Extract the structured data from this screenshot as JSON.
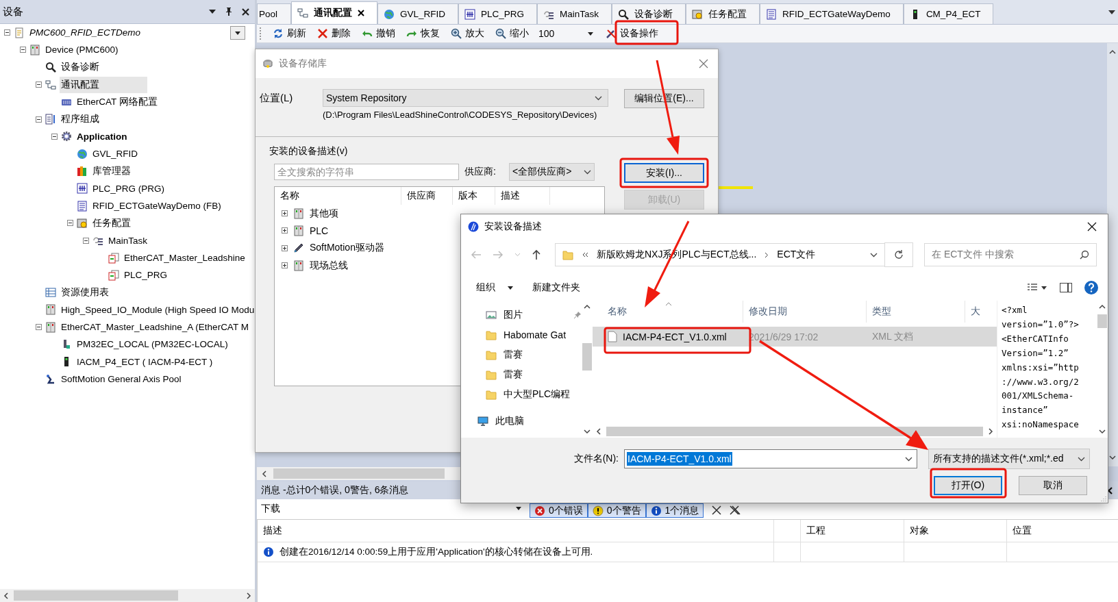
{
  "device_panel": {
    "title": "设备",
    "tree": [
      {
        "label": "PMC600_RFID_ECTDemo",
        "kind": "project",
        "expanded": true,
        "selected": false,
        "children": [
          {
            "label": "Device (PMC600)",
            "kind": "device",
            "expanded": true,
            "selected": false,
            "children": [
              {
                "label": "设备诊断",
                "kind": "diagnosis",
                "selected": false
              },
              {
                "label": "通讯配置",
                "kind": "network",
                "expanded": true,
                "selected": true,
                "children": [
                  {
                    "label": "EtherCAT 网络配置",
                    "kind": "ethercat",
                    "selected": false
                  }
                ]
              },
              {
                "label": "程序组成",
                "kind": "program",
                "expanded": true,
                "selected": false,
                "children": [
                  {
                    "label": "Application",
                    "kind": "application",
                    "expanded": true,
                    "selected": false,
                    "children": [
                      {
                        "label": "GVL_RFID",
                        "kind": "globe",
                        "selected": false
                      },
                      {
                        "label": "库管理器",
                        "kind": "library",
                        "selected": false
                      },
                      {
                        "label": "PLC_PRG (PRG)",
                        "kind": "pou",
                        "selected": false
                      },
                      {
                        "label": "RFID_ECTGateWayDemo (FB)",
                        "kind": "doc",
                        "selected": false
                      },
                      {
                        "label": "任务配置",
                        "kind": "task_config",
                        "expanded": true,
                        "selected": false,
                        "children": [
                          {
                            "label": "MainTask",
                            "kind": "task",
                            "expanded": true,
                            "selected": false,
                            "children": [
                              {
                                "label": "EtherCAT_Master_Leadshine",
                                "kind": "call",
                                "selected": false
                              },
                              {
                                "label": "PLC_PRG",
                                "kind": "call",
                                "selected": false
                              }
                            ]
                          }
                        ]
                      }
                    ]
                  }
                ]
              },
              {
                "label": "资源使用表",
                "kind": "table",
                "selected": false
              },
              {
                "label": "High_Speed_IO_Module (High Speed IO Modu",
                "kind": "device",
                "selected": false
              },
              {
                "label": "EtherCAT_Master_Leadshine_A (EtherCAT M",
                "kind": "device",
                "expanded": true,
                "selected": false,
                "children": [
                  {
                    "label": "PM32EC_LOCAL (PM32EC-LOCAL)",
                    "kind": "servo",
                    "selected": false
                  },
                  {
                    "label": "IACM_P4_ECT ( IACM-P4-ECT )",
                    "kind": "drive",
                    "selected": false
                  }
                ]
              },
              {
                "label": "SoftMotion General Axis Pool",
                "kind": "axis",
                "selected": false
              }
            ]
          }
        ]
      }
    ]
  },
  "tabs": [
    {
      "label": "Pool",
      "kind": "plain",
      "selected": false
    },
    {
      "label": "通讯配置",
      "kind": "network",
      "selected": true
    },
    {
      "label": "GVL_RFID",
      "kind": "globe",
      "selected": false
    },
    {
      "label": "PLC_PRG",
      "kind": "pou",
      "selected": false
    },
    {
      "label": "MainTask",
      "kind": "task",
      "selected": false
    },
    {
      "label": "设备诊断",
      "kind": "diagnosis",
      "selected": false
    },
    {
      "label": "任务配置",
      "kind": "task_config",
      "selected": false
    },
    {
      "label": "RFID_ECTGateWayDemo",
      "kind": "doc",
      "selected": false
    },
    {
      "label": "CM_P4_ECT",
      "kind": "drive",
      "selected": false
    }
  ],
  "toolbar": {
    "buttons": [
      {
        "label": "刷新",
        "kind": "refresh"
      },
      {
        "label": "删除",
        "kind": "delete"
      },
      {
        "label": "撤销",
        "kind": "undo"
      },
      {
        "label": "恢复",
        "kind": "redo"
      },
      {
        "label": "放大",
        "kind": "zoom_in"
      },
      {
        "label": "缩小",
        "kind": "zoom_out"
      }
    ],
    "zoom": "100",
    "device_button": "设备操作"
  },
  "repository_dialog": {
    "title": "设备存储库",
    "location_label": "位置(L)",
    "location": "System Repository",
    "edit_button": "编辑位置(E)...",
    "path": "(D:\\Program Files\\LeadShineControl\\CODESYS_Repository\\Devices)",
    "section_label": "安装的设备描述(v)",
    "search_placeholder": "全文搜索的字符串",
    "vendor_label": "供应商:",
    "vendor": "<全部供应商>",
    "buttons": [
      {
        "label": "安装(I)...",
        "disabled": false
      },
      {
        "label": "卸载(U)",
        "disabled": true
      }
    ],
    "columns": [
      "名称",
      "供应商",
      "版本",
      "描述"
    ],
    "items": [
      {
        "label": "其他项",
        "kind": "device",
        "expanded": false
      },
      {
        "label": "PLC",
        "kind": "device",
        "expanded": false
      },
      {
        "label": "SoftMotion驱动器",
        "kind": "pen",
        "expanded": false
      },
      {
        "label": "现场总线",
        "kind": "device",
        "expanded": false
      }
    ]
  },
  "file_dialog": {
    "title": "安装设备描述",
    "breadcrumb": [
      "新版欧姆龙NXJ系列PLC与ECT总线...",
      "ECT文件"
    ],
    "search_placeholder": "在 ECT文件 中搜索",
    "organize": "组织",
    "new_folder": "新建文件夹",
    "nav_items": [
      {
        "label": "图片",
        "kind": "pictures",
        "pinned": true
      },
      {
        "label": "Habomate Gat",
        "kind": "folder",
        "pinned": false
      },
      {
        "label": "雷赛",
        "kind": "folder",
        "pinned": false
      },
      {
        "label": "雷赛",
        "kind": "folder",
        "pinned": false
      },
      {
        "label": "中大型PLC编程",
        "kind": "folder",
        "pinned": false
      },
      {
        "label": "此电脑",
        "kind": "computer",
        "pinned": false
      }
    ],
    "columns": [
      "名称",
      "修改日期",
      "类型",
      "大"
    ],
    "files": [
      {
        "name": "IACM-P4-ECT_V1.0.xml",
        "date": "2021/6/29 17:02",
        "type": "XML 文档",
        "selected": true
      }
    ],
    "preview": [
      "<?xml",
      "version=”1.0”?>",
      "<EtherCATInfo",
      "Version=”1.2”",
      "xmlns:xsi=”http",
      "://www.w3.org/2",
      "001/XMLSchema-",
      "instance”",
      "xsi:noNamespace"
    ],
    "filename_label": "文件名(N):",
    "filename": "IACM-P4-ECT_V1.0.xml",
    "filter": "所有支持的描述文件(*.xml;*.ed",
    "open_button": "打开(O)",
    "cancel_button": "取消"
  },
  "messages": {
    "title": "消息 -总计0个错误, 0警告, 6条消息",
    "source": "下载",
    "filters": [
      {
        "label": "0个错误",
        "kind": "error",
        "selected": true
      },
      {
        "label": "0个警告",
        "kind": "warning",
        "selected": true
      },
      {
        "label": "1个消息",
        "kind": "info",
        "selected": true
      }
    ],
    "columns": [
      "描述",
      "",
      "工程",
      "对象",
      "位置"
    ],
    "rows": [
      {
        "kind": "info",
        "text": "创建在2016/12/14 0:00:59上用于应用'Application'的核心转储在设备上可用."
      }
    ]
  }
}
